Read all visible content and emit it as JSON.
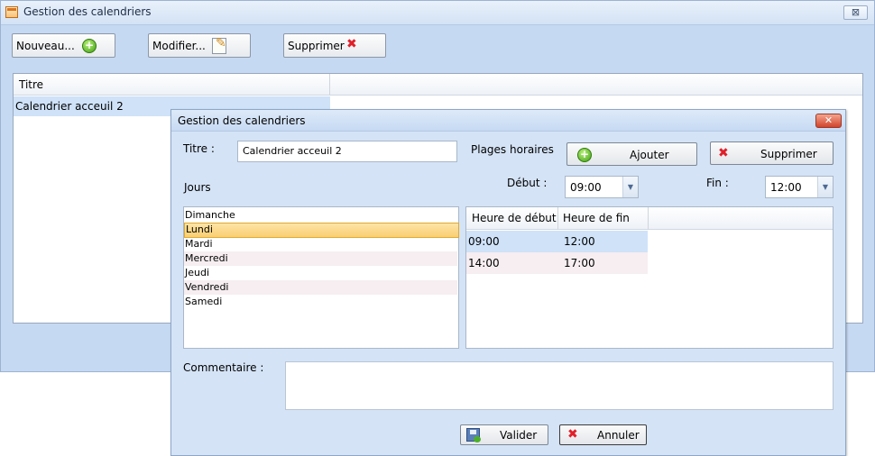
{
  "main_window": {
    "title": "Gestion des calendriers",
    "close_glyph": "⊠",
    "toolbar": {
      "new_label": "Nouveau...",
      "edit_label": "Modifier...",
      "delete_label": "Supprimer"
    },
    "grid": {
      "column_title": "Titre",
      "rows": [
        "Calendrier acceuil 2"
      ]
    }
  },
  "dialog": {
    "title": "Gestion des calendriers",
    "close_glyph": "✕",
    "title_label": "Titre :",
    "title_value": "Calendrier acceuil 2",
    "plages_label": "Plages horaires",
    "add_button": "Ajouter",
    "remove_button": "Supprimer",
    "jours_label": "Jours",
    "debut_label": "Début :",
    "debut_value": "09:00",
    "fin_label": "Fin :",
    "fin_value": "12:00",
    "days": [
      "Dimanche",
      "Lundi",
      "Mardi",
      "Mercredi",
      "Jeudi",
      "Vendredi",
      "Samedi"
    ],
    "selected_day": "Lundi",
    "slots": {
      "headers": [
        "Heure de début",
        "Heure de fin"
      ],
      "rows": [
        {
          "start": "09:00",
          "end": "12:00"
        },
        {
          "start": "14:00",
          "end": "17:00"
        }
      ]
    },
    "comment_label": "Commentaire :",
    "comment_value": "",
    "ok_button": "Valider",
    "cancel_button": "Annuler"
  },
  "icons": {
    "plus": "add-icon",
    "delete": "delete-x-icon",
    "edit": "edit-pencil-icon",
    "save": "save-disk-icon",
    "app": "calendar-app-icon"
  },
  "colors": {
    "window_bg": "#c6d9f2",
    "dialog_bg": "#d4e3f6",
    "selection_blue": "#cfe2f8",
    "selection_orange": "#f9cf72",
    "delete_red": "#e0202a",
    "add_green": "#3f9e12"
  }
}
